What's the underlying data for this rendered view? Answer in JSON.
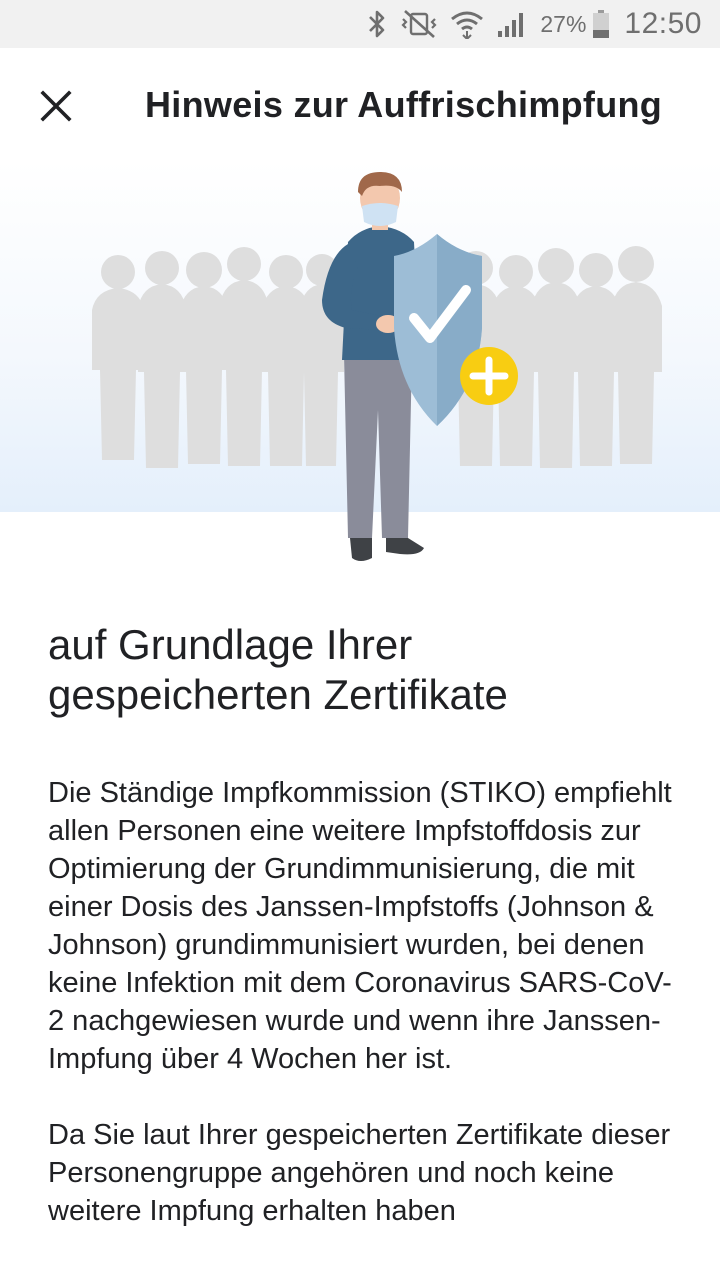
{
  "status_bar": {
    "battery": "27%",
    "time": "12:50",
    "icons": [
      "bluetooth-icon",
      "vibrate-mute-icon",
      "wifi-icon",
      "cell-signal-icon",
      "battery-icon"
    ]
  },
  "header": {
    "title": "Hinweis zur Auffrischimpfung",
    "close_icon": "close-icon"
  },
  "hero": {
    "illustration": "person-with-shield-icon",
    "badge_icon": "plus-icon"
  },
  "main": {
    "heading": "auf Grundlage Ihrer gespeicherten Zertifikate",
    "paragraph1": "Die Ständige Impfkommission (STIKO) empfiehlt allen Personen eine weitere Impfstoffdosis zur Optimierung der Grundimmunisierung, die mit einer Dosis des Janssen-Impfstoffs (Johnson & Johnson) grundimmunisiert wurden, bei denen keine Infektion mit dem Coronavirus SARS-CoV-2 nachgewiesen wurde und wenn ihre Janssen-Impfung über 4 Wochen her ist.",
    "paragraph2": "Da Sie laut Ihrer gespeicherten Zertifikate dieser Personengruppe angehören und noch keine weitere Impfung erhalten haben"
  },
  "colors": {
    "shield": "#9dbdd6",
    "badge": "#f8cd12",
    "crowd": "#dedede",
    "jacket": "#3d6789",
    "trousers": "#8a8c9a"
  }
}
